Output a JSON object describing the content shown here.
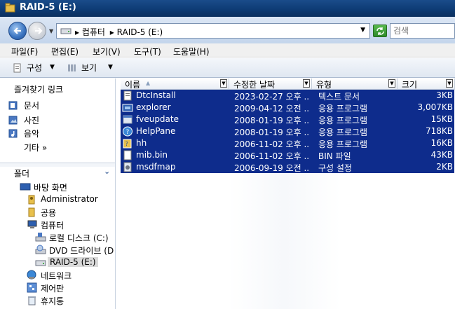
{
  "window": {
    "title": "RAID-5 (E:)"
  },
  "address": {
    "crumbs": [
      "▸ 컴퓨터",
      "▸ RAID-5 (E:)"
    ],
    "search_placeholder": "검색"
  },
  "menu": [
    "파일(F)",
    "편집(E)",
    "보기(V)",
    "도구(T)",
    "도움말(H)"
  ],
  "toolbar": {
    "organize": "구성",
    "views": "보기"
  },
  "favorites": {
    "title": "즐겨찾기 링크",
    "items": [
      "문서",
      "사진",
      "음악"
    ],
    "more": "기타 »"
  },
  "folders": {
    "title": "폴더",
    "tree": [
      {
        "label": "바탕 화면",
        "icon": "desktop-icon"
      },
      {
        "label": "Administrator",
        "icon": "user-folder-icon"
      },
      {
        "label": "공용",
        "icon": "folder-icon"
      },
      {
        "label": "컴퓨터",
        "icon": "computer-icon"
      },
      {
        "label": "로컬 디스크 (C:)",
        "icon": "hard-disk-icon"
      },
      {
        "label": "DVD 드라이브 (D",
        "icon": "dvd-drive-icon"
      },
      {
        "label": "RAID-5 (E:)",
        "icon": "drive-icon"
      },
      {
        "label": "네트워크",
        "icon": "network-icon"
      },
      {
        "label": "제어판",
        "icon": "control-panel-icon"
      },
      {
        "label": "휴지통",
        "icon": "recycle-bin-icon"
      }
    ]
  },
  "columns": {
    "name": "이름",
    "date": "수정한 날짜",
    "type": "유형",
    "size": "크기"
  },
  "files": [
    {
      "name": "DtcInstall",
      "date": "2023-02-27 오후 ...",
      "type": "텍스트 문서",
      "size": "3KB",
      "icon": "text-file-icon"
    },
    {
      "name": "explorer",
      "date": "2009-04-12 오전 ...",
      "type": "응용 프로그램",
      "size": "3,007KB",
      "icon": "explorer-icon"
    },
    {
      "name": "fveupdate",
      "date": "2008-01-19 오후 ...",
      "type": "응용 프로그램",
      "size": "15KB",
      "icon": "app-icon"
    },
    {
      "name": "HelpPane",
      "date": "2008-01-19 오후 ...",
      "type": "응용 프로그램",
      "size": "718KB",
      "icon": "help-icon"
    },
    {
      "name": "hh",
      "date": "2006-11-02 오후 ...",
      "type": "응용 프로그램",
      "size": "16KB",
      "icon": "help-book-icon"
    },
    {
      "name": "mib.bin",
      "date": "2006-11-02 오후 ...",
      "type": "BIN 파일",
      "size": "43KB",
      "icon": "bin-file-icon"
    },
    {
      "name": "msdfmap",
      "date": "2006-09-19 오전 ...",
      "type": "구성 설정",
      "size": "2KB",
      "icon": "config-file-icon"
    }
  ],
  "colors": {
    "selection": "#0e2c8c",
    "titlebar": "#0d3a73"
  }
}
